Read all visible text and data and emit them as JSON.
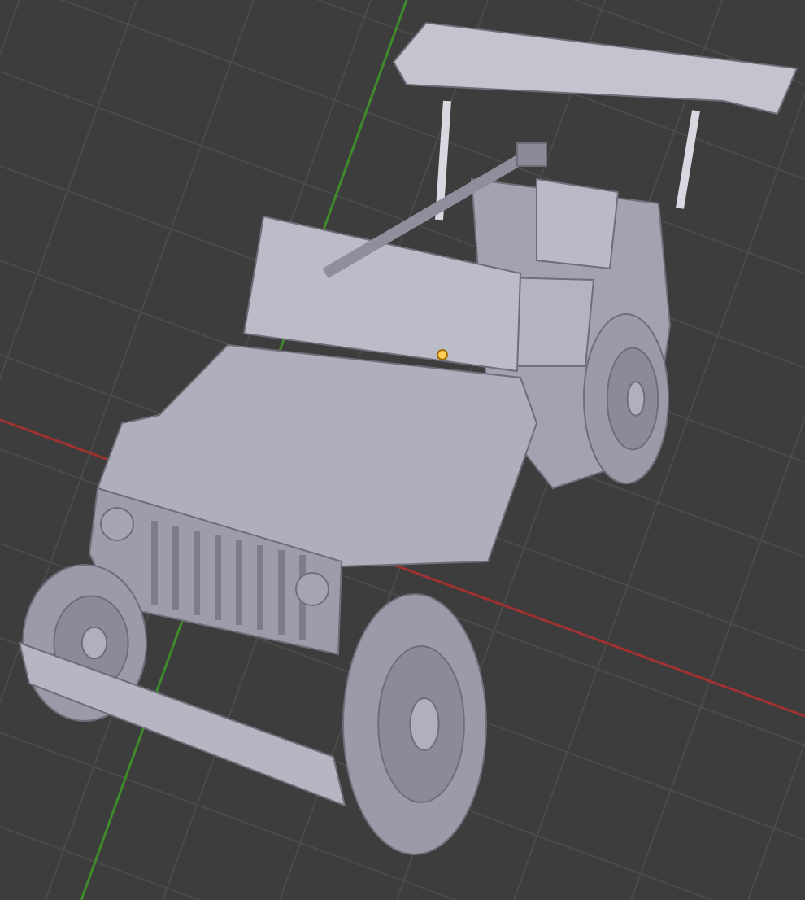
{
  "viewport": {
    "grid": true,
    "axes": [
      {
        "kind": "x",
        "color": "#a03232"
      },
      {
        "kind": "y",
        "color": "#3f8a2a"
      }
    ],
    "model": {
      "kind": "jeep"
    }
  }
}
